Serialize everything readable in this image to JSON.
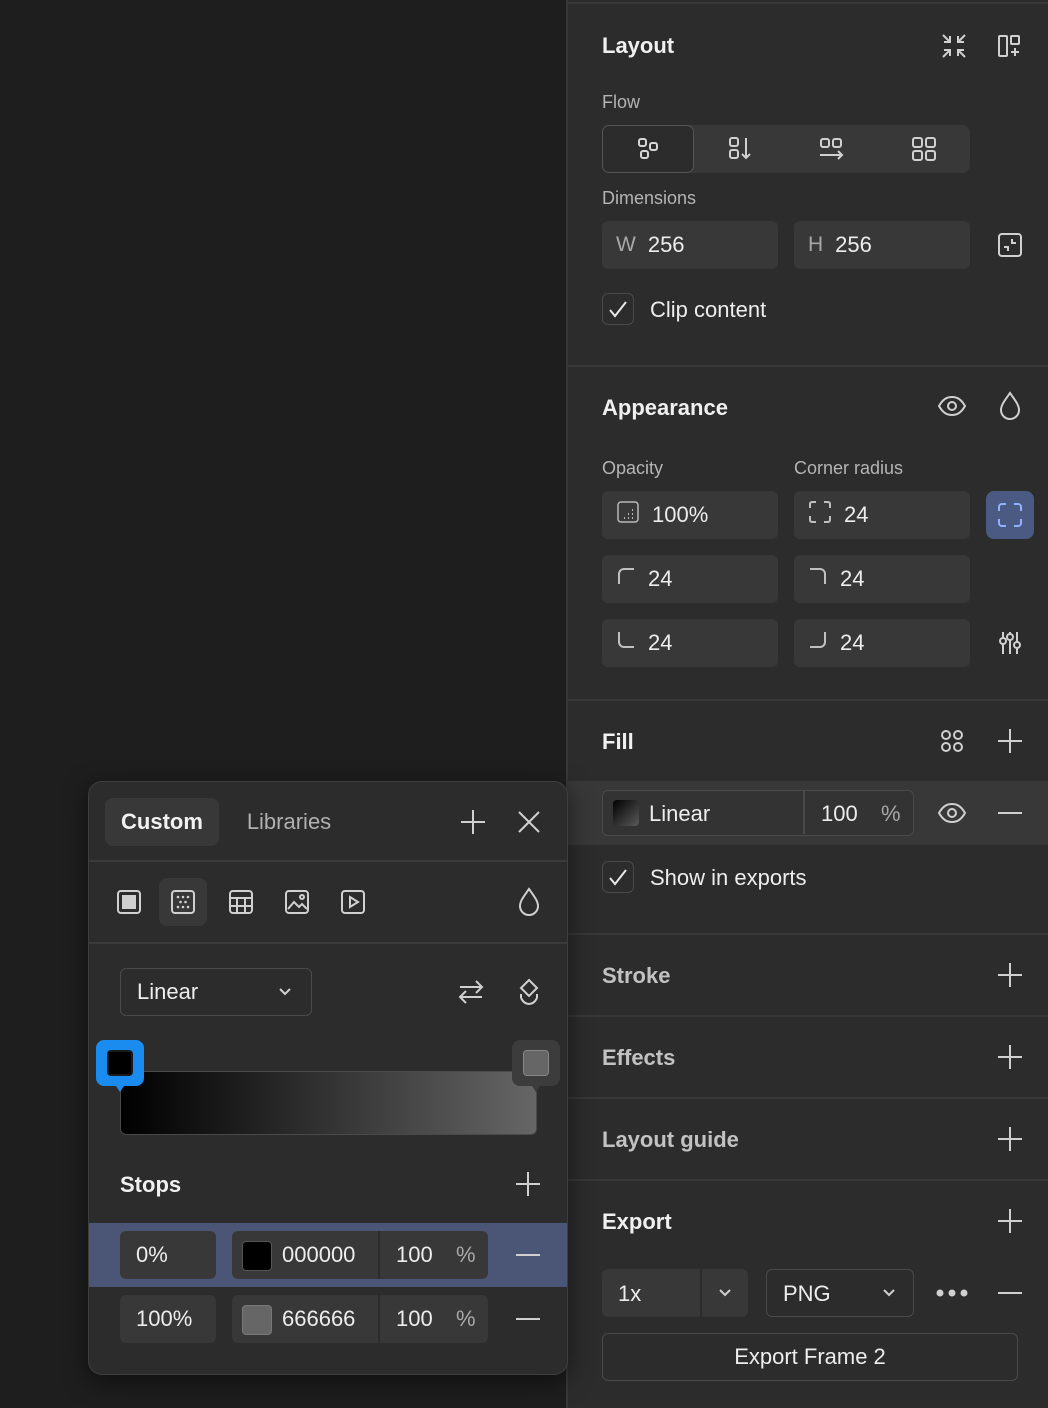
{
  "layout": {
    "title": "Layout",
    "flow_label": "Flow",
    "dimensions_label": "Dimensions",
    "width_prefix": "W",
    "width_value": "256",
    "height_prefix": "H",
    "height_value": "256",
    "clip_label": "Clip content",
    "clip_checked": true
  },
  "appearance": {
    "title": "Appearance",
    "opacity_label": "Opacity",
    "opacity_value": "100%",
    "corner_label": "Corner radius",
    "corner_all": "24",
    "corner_tl": "24",
    "corner_tr": "24",
    "corner_bl": "24",
    "corner_br": "24"
  },
  "fill": {
    "title": "Fill",
    "type": "Linear",
    "opacity": "100",
    "percent": "%",
    "show_exports_label": "Show in exports",
    "show_exports_checked": true
  },
  "sections": {
    "stroke": "Stroke",
    "effects": "Effects",
    "layout_guide": "Layout guide"
  },
  "export": {
    "title": "Export",
    "scale": "1x",
    "format": "PNG",
    "button": "Export Frame 2"
  },
  "picker": {
    "tab_custom": "Custom",
    "tab_libraries": "Libraries",
    "gradient_type": "Linear",
    "stops_label": "Stops",
    "stops": [
      {
        "position": "0%",
        "hex": "000000",
        "opacity": "100",
        "percent": "%",
        "color": "#000000",
        "selected": true
      },
      {
        "position": "100%",
        "hex": "666666",
        "opacity": "100",
        "percent": "%",
        "color": "#666666",
        "selected": false
      }
    ]
  },
  "colors": {
    "panel_bg": "#2c2c2c",
    "canvas_bg": "#1e1e1e",
    "accent": "#1a8cf0",
    "selected_row": "#4b5676",
    "corner_toggle_active": "#4a5a82"
  }
}
